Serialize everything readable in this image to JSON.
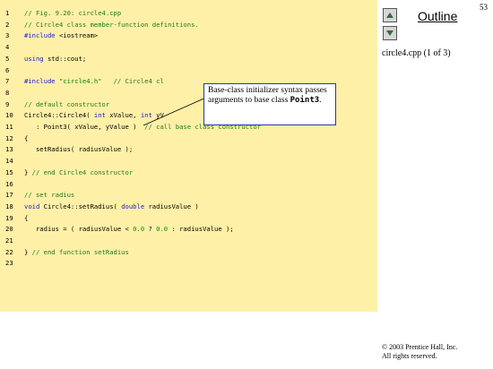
{
  "page_number": "53",
  "outline": {
    "title": "Outline",
    "file_label": "circle4.cpp (1 of 3)"
  },
  "copyright": {
    "line1": "© 2003 Prentice Hall, Inc.",
    "line2": "All rights reserved."
  },
  "callout": {
    "text": "Base-class initializer syntax passes arguments to base class ",
    "code": "Point3",
    "tail": "."
  },
  "code_lines": [
    {
      "n": "1",
      "parts": [
        {
          "t": "// Fig. 9.20: circle4.cpp",
          "c": "cmt"
        }
      ]
    },
    {
      "n": "2",
      "parts": [
        {
          "t": "// Circle4 class member-function definitions.",
          "c": "cmt"
        }
      ]
    },
    {
      "n": "3",
      "parts": [
        {
          "t": "#include",
          "c": "kw"
        },
        {
          "t": " <iostream>",
          "c": ""
        }
      ]
    },
    {
      "n": "4",
      "parts": []
    },
    {
      "n": "5",
      "parts": [
        {
          "t": "using",
          "c": "kw"
        },
        {
          "t": " std::cout;",
          "c": ""
        }
      ]
    },
    {
      "n": "6",
      "parts": []
    },
    {
      "n": "7",
      "parts": [
        {
          "t": "#include",
          "c": "kw"
        },
        {
          "t": " ",
          "c": ""
        },
        {
          "t": "\"circle4.h\"",
          "c": "str"
        },
        {
          "t": "   ",
          "c": ""
        },
        {
          "t": "// Circle4 cl",
          "c": "cmt"
        }
      ]
    },
    {
      "n": "8",
      "parts": []
    },
    {
      "n": "9",
      "parts": [
        {
          "t": "// default constructor",
          "c": "cmt"
        }
      ]
    },
    {
      "n": "10",
      "parts": [
        {
          "t": "Circle4::Circle4( ",
          "c": ""
        },
        {
          "t": "int",
          "c": "kw"
        },
        {
          "t": " xValue, ",
          "c": ""
        },
        {
          "t": "int",
          "c": "kw"
        },
        {
          "t": " yV",
          "c": ""
        }
      ]
    },
    {
      "n": "11",
      "parts": [
        {
          "t": "   : Point3( xValue, yValue )  ",
          "c": ""
        },
        {
          "t": "// call base class constructor",
          "c": "cmt"
        }
      ]
    },
    {
      "n": "12",
      "parts": [
        {
          "t": "{",
          "c": ""
        }
      ]
    },
    {
      "n": "13",
      "parts": [
        {
          "t": "   setRadius( radiusValue );",
          "c": ""
        }
      ]
    },
    {
      "n": "14",
      "parts": []
    },
    {
      "n": "15",
      "parts": [
        {
          "t": "} ",
          "c": ""
        },
        {
          "t": "// end Circle4 constructor",
          "c": "cmt"
        }
      ]
    },
    {
      "n": "16",
      "parts": []
    },
    {
      "n": "17",
      "parts": [
        {
          "t": "// set radius",
          "c": "cmt"
        }
      ]
    },
    {
      "n": "18",
      "parts": [
        {
          "t": "void",
          "c": "kw"
        },
        {
          "t": " Circle4::setRadius( ",
          "c": ""
        },
        {
          "t": "double",
          "c": "kw"
        },
        {
          "t": " radiusValue )",
          "c": ""
        }
      ]
    },
    {
      "n": "19",
      "parts": [
        {
          "t": "{",
          "c": ""
        }
      ]
    },
    {
      "n": "20",
      "parts": [
        {
          "t": "   radius = ( radiusValue < ",
          "c": ""
        },
        {
          "t": "0.0",
          "c": "num"
        },
        {
          "t": " ? ",
          "c": ""
        },
        {
          "t": "0.0",
          "c": "num"
        },
        {
          "t": " : radiusValue );",
          "c": ""
        }
      ]
    },
    {
      "n": "21",
      "parts": []
    },
    {
      "n": "22",
      "parts": [
        {
          "t": "} ",
          "c": ""
        },
        {
          "t": "// end function setRadius",
          "c": "cmt"
        }
      ]
    },
    {
      "n": "23",
      "parts": []
    }
  ]
}
